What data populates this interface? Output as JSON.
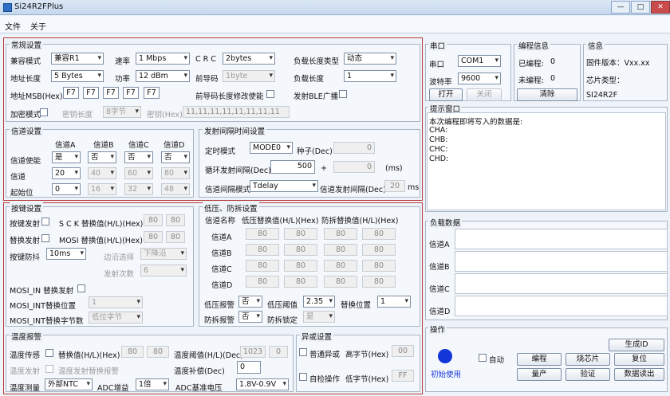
{
  "window": {
    "title": "Si24R2FPlus",
    "min": "—",
    "max": "□",
    "close": "✕"
  },
  "menu": [
    "文件",
    "关于"
  ],
  "basic": {
    "title": "常规设置",
    "mode_l": "兼容模式",
    "mode_v": "兼容R1",
    "rate_l": "速率",
    "rate_v": "1 Mbps",
    "crc_l": "C R C",
    "crc_v": "2bytes",
    "plt_l": "负载长度类型",
    "plt_v": "动态",
    "aw_l": "地址长度",
    "aw_v": "5 Bytes",
    "pwr_l": "功率",
    "pwr_v": "12  dBm",
    "pre_l": "前导码",
    "pre_v": "1byte",
    "pl_l": "负载长度",
    "pl_v": "1",
    "addr_l": "地址MSB(Hex)",
    "addr": [
      "F7",
      "F7",
      "F7",
      "F7",
      "F7"
    ],
    "premod_l": "前导码长度修改使能",
    "ble_l": "发射BLE广播",
    "scr_l": "加密模式",
    "keylen_l": "密钥长度",
    "keylen_v": "8字节",
    "key_l": "密钥(Hex)",
    "key_v": "11,11,11,11,11,11,11,11"
  },
  "channel": {
    "title": "信道设置",
    "ha": "信道A",
    "hb": "信道B",
    "hc": "信道C",
    "hd": "信道D",
    "en_l": "信道使能",
    "en": [
      "是",
      "否",
      "否",
      "否"
    ],
    "ch_l": "信道",
    "ch": [
      "20",
      "40",
      "60",
      "80"
    ],
    "st_l": "起始位",
    "st": [
      "0",
      "16",
      "32",
      "48"
    ]
  },
  "tx": {
    "title": "发射间隔时间设置",
    "mode_l": "定时模式",
    "mode_v": "MODE0",
    "seed_l": "种子(Dec)",
    "seed_v": "0",
    "cyc_l": "循环发射间隔(Dec)",
    "cyc_v": "500",
    "plus": "+",
    "cyc2_v": "0",
    "ms": "(ms)",
    "chm_l": "信道间隔模式",
    "chm_v": "Tdelay",
    "chi_l": "信道发射间隔(Dec)",
    "chi_v": "20",
    "ms2": "ms"
  },
  "keys": {
    "title": "按键设置",
    "k1_l": "按键发射",
    "sck_l": "S C K 替换值(H/L)(Hex)",
    "sck": [
      "80",
      "80"
    ],
    "k2_l": "替换发射",
    "mosi_l": "MOSI 替换值(H/L)(Hex)",
    "mosi": [
      "80",
      "80"
    ],
    "deb_l": "按键防抖",
    "deb_v": "10ms",
    "edge_l": "边沿选择",
    "edge_v": "下降沿",
    "cnt_l": "发射次数",
    "cnt_v": "6",
    "mo1_l": "MOSI_IN 替换发射",
    "mo2_l": "MOSI_INT替换位置",
    "mo2_v": "1",
    "mo3_l": "MOSI_INT替换字节数",
    "mo3_v": "低位字节"
  },
  "lv": {
    "title": "低压、防拆设置",
    "h1": "信道名称",
    "h2": "低压替换值(H/L)(Hex)",
    "h3": "防拆替换值(H/L)(Hex)",
    "rows": [
      {
        "n": "信道A",
        "v": [
          "80",
          "80",
          "80",
          "80"
        ]
      },
      {
        "n": "信道B",
        "v": [
          "80",
          "80",
          "80",
          "80"
        ]
      },
      {
        "n": "信道C",
        "v": [
          "80",
          "80",
          "80",
          "80"
        ]
      },
      {
        "n": "信道D",
        "v": [
          "80",
          "80",
          "80",
          "80"
        ]
      }
    ],
    "lvr_l": "低压报警",
    "lvr_v": "否",
    "lvt_l": "低压阈值",
    "lvt_v": "2.35",
    "rp_l": "替换位置",
    "rp_v": "1",
    "tr_l": "防拆报警",
    "tr_v": "否",
    "tl_l": "防拆锁定",
    "tl_v": "是"
  },
  "temp": {
    "title": "温度报警",
    "t1_l": "温度传感",
    "t1b_l": "替换值(H/L)(Hex)",
    "t1v": [
      "80",
      "80"
    ],
    "th_l": "温度阈值(H/L)(Dec)",
    "thv": [
      "1023",
      "0"
    ],
    "t2_l": "温度发射",
    "t2b_l": "温度发射替换报警",
    "comp_l": "温度补偿(Dec)",
    "comp_v": "0",
    "meas_l": "温度测量",
    "meas_v": "外部NTC",
    "gain_l": "ADC增益",
    "gain_v": "1倍",
    "ref_l": "ADC基准电压",
    "ref_v": "1.8V-0.9V"
  },
  "xor": {
    "title": "异或设置",
    "a1": "普通异或",
    "a1b": "高字节(Hex)",
    "a1v": "00",
    "a2": "自检操作",
    "a2b": "低字节(Hex)",
    "a2v": "FF"
  },
  "serial": {
    "title": "串口",
    "port_l": "串口",
    "port_v": "COM1",
    "baud_l": "波特率",
    "baud_v": "9600",
    "open": "打开",
    "close": "关闭"
  },
  "prog": {
    "title": "编程信息",
    "done_l": "已编程:",
    "done_v": "0",
    "todo_l": "未编程:",
    "todo_v": "0",
    "clear": "清除"
  },
  "info": {
    "title": "信息",
    "fw": "固件版本：Vxx.xx",
    "chip": "芯片类型：",
    "chipv": "SI24R2F"
  },
  "tip": {
    "title": "提示窗口",
    "line1": "本次编程即将写入的数据是:",
    "l2": "CHA:",
    "l3": "CHB:",
    "l4": "CHC:",
    "l5": "CHD:"
  },
  "payload": {
    "title": "负载数据",
    "rows": [
      "信道A",
      "信道B",
      "信道C",
      "信道D"
    ]
  },
  "op": {
    "title": "操作",
    "gen": "生成ID",
    "auto_l": "自动",
    "prog": "编程",
    "burn": "烧芯片",
    "reset": "复位",
    "mass": "量产",
    "verify": "验证",
    "readback": "数据读出",
    "status": "初始使用",
    "status_color": "#1336d8"
  }
}
